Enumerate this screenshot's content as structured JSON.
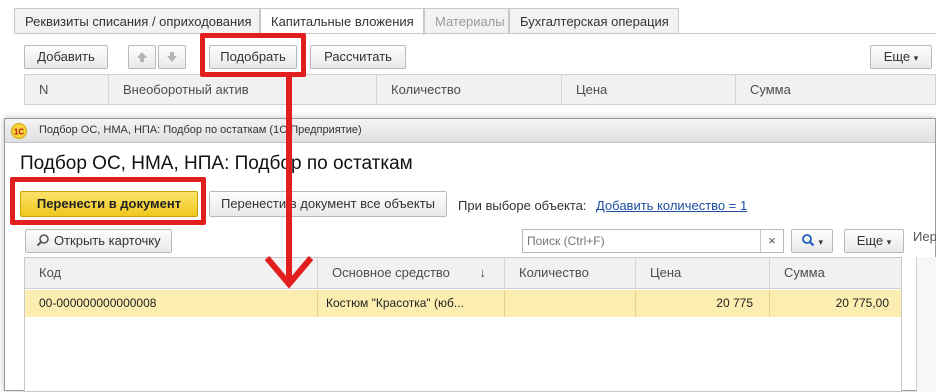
{
  "top_form": {
    "tabs": [
      {
        "label": "Реквизиты списания / оприходования",
        "state": "normal"
      },
      {
        "label": "Капитальные вложения",
        "state": "active"
      },
      {
        "label": "Материалы",
        "state": "disabled"
      },
      {
        "label": "Бухгалтерская операция",
        "state": "normal"
      }
    ],
    "toolbar": {
      "add_label": "Добавить",
      "pick_label": "Подобрать",
      "calculate_label": "Рассчитать",
      "more_label": "Еще"
    },
    "table_headers": [
      "N",
      "Внеоборотный актив",
      "Количество",
      "Цена",
      "Сумма"
    ]
  },
  "dialog": {
    "window_title": "Подбор ОС, НМА, НПА: Подбор по остаткам  (1С:Предприятие)",
    "heading": "Подбор ОС, НМА, НПА: Подбор по остаткам",
    "transfer_button": "Перенести в документ",
    "transfer_all_button": "Перенести в документ все объекты",
    "selection_label": "При выборе объекта:",
    "selection_link": "Добавить количество = 1",
    "open_card_button": "Открыть карточку",
    "search_placeholder": "Поиск (Ctrl+F)",
    "clear_glyph": "×",
    "more_label": "Еще",
    "side_label": "Иер",
    "table": {
      "headers": [
        "Код",
        "Основное средство",
        "Количество",
        "Цена",
        "Сумма"
      ],
      "sort_glyph": "↓",
      "rows": [
        {
          "code": "00-000000000000008",
          "asset": "Костюм \"Красотка\" (юб...",
          "quantity": "",
          "price": "20 775",
          "sum": "20 775,00"
        }
      ]
    }
  },
  "colors": {
    "annotation_red": "#e21e1e",
    "primary_button": "#f4d22a",
    "selected_row": "#fbeeb0",
    "link": "#1d4ea3"
  },
  "icons": [
    "arrow-up-icon",
    "arrow-down-icon",
    "app-logo-icon",
    "magnifier-icon",
    "search-icon",
    "dropdown-caret-icon",
    "red-arrow-annotation-icon"
  ]
}
